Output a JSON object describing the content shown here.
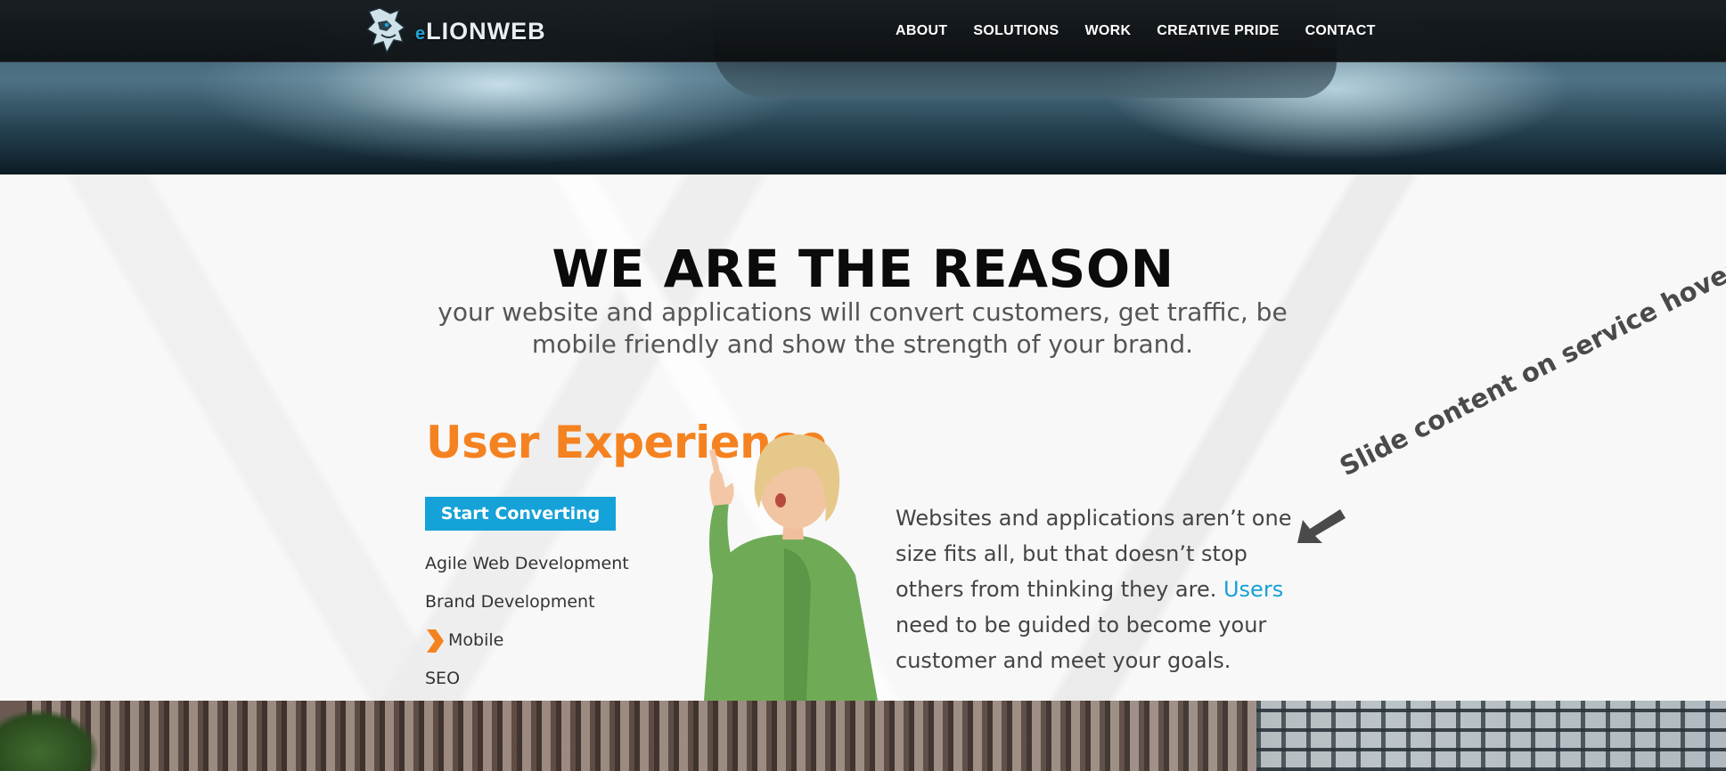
{
  "header": {
    "logo": {
      "prefix": "e",
      "name": "LIONWEB",
      "icon": "lion-head-icon"
    },
    "nav": [
      {
        "label": "ABOUT"
      },
      {
        "label": "SOLUTIONS"
      },
      {
        "label": "WORK"
      },
      {
        "label": "CREATIVE PRIDE"
      },
      {
        "label": "CONTACT"
      }
    ]
  },
  "hero_section": {
    "headline": "WE ARE THE REASON",
    "subhead": "your website and applications will convert customers, get traffic, be mobile friendly and show the strength of your brand."
  },
  "service": {
    "title": "User Experience",
    "cta_label": "Start Converting",
    "items": [
      {
        "label": "Agile Web Development",
        "active": false
      },
      {
        "label": "Brand Development",
        "active": false
      },
      {
        "label": "Mobile",
        "active": true
      },
      {
        "label": "SEO",
        "active": false
      }
    ],
    "description_before": "Websites and applications aren’t one size fits all, but that doesn’t stop others from thinking they are. ",
    "description_highlight": "Users",
    "description_after": " need to be guided to become your customer and meet your goals."
  },
  "annotation": {
    "text": "Slide content on service hover",
    "icon": "arrow-pointer-icon"
  },
  "colors": {
    "accent_orange": "#f58220",
    "accent_blue": "#15a2d8",
    "text_dark": "#0b0b0b",
    "text_body": "#444444"
  }
}
